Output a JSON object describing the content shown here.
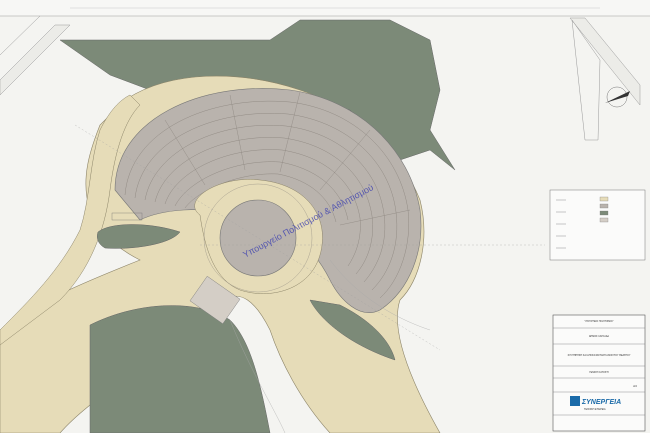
{
  "sheet": {
    "watermark": "Υπουργείο Πολιτισμού & Αθλητισμού"
  },
  "title_block": {
    "org_line": "ΥΠΟΥΡΓΕΙΟ ΠΟΛΙΤΙΣΜΟΥ",
    "municipality": "ΔΗΜΟΣ ΛΑΓΚΑΔΑ",
    "project_title": "ΣΥΝΤΗΡΗΣΗ ΚΑΙ ΑΠΟΚΑΤΑΣΤΑΣΗ ΑΝΟΙΧΤΟΥ ΘΕΑΤΡΟΥ",
    "drawing_title": "ΓΕΝΙΚΗ ΚΑΤΟΨΗ",
    "sheet_no": "Α3",
    "company": "ΣΥΝΕΡΓΕΙΑ",
    "company_sub": "ΤΕΧΝΙΚΗ ΕΤΑΙΡΕΙΑ"
  },
  "palette": {
    "background": "#f4f4f1",
    "paved_path": "#e6dcb8",
    "seating": "#b9b3ad",
    "lawn": "#7c8a78",
    "lines": "#8a8a8a"
  },
  "legend": {
    "entries": [
      "—",
      "—",
      "—",
      "—",
      "—",
      "—"
    ]
  }
}
